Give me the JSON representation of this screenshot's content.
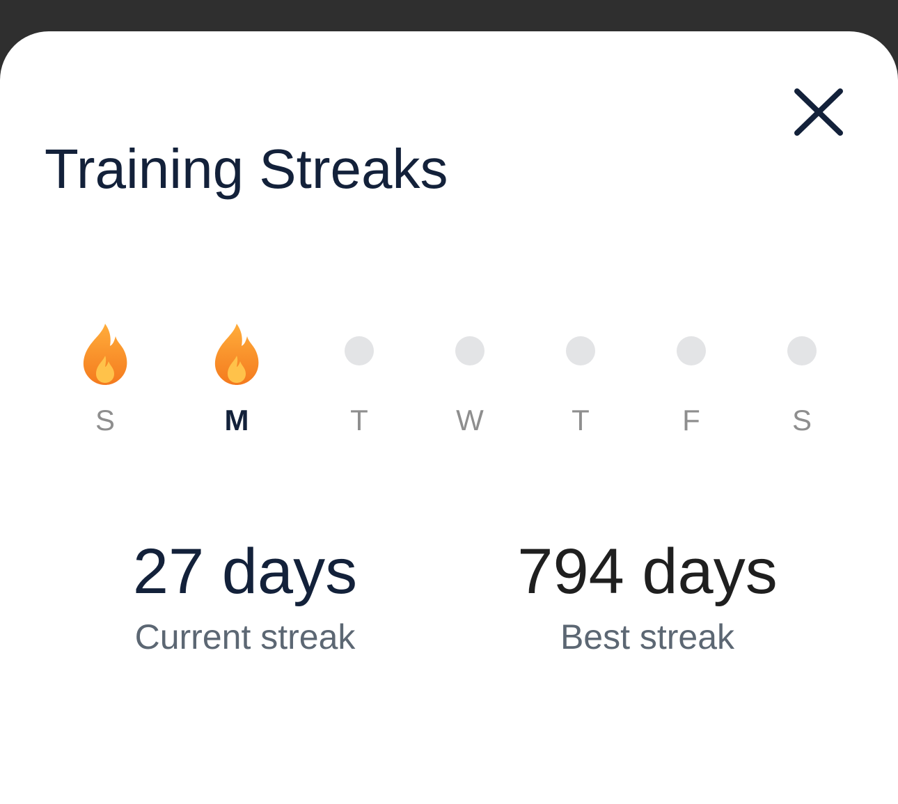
{
  "modal": {
    "title": "Training Streaks",
    "close_icon": "close-icon"
  },
  "week": {
    "days": [
      {
        "letter": "S",
        "state": "completed",
        "icon": "flame-icon"
      },
      {
        "letter": "M",
        "state": "completed",
        "icon": "flame-icon",
        "today": true
      },
      {
        "letter": "T",
        "state": "empty"
      },
      {
        "letter": "W",
        "state": "empty"
      },
      {
        "letter": "T",
        "state": "empty"
      },
      {
        "letter": "F",
        "state": "empty"
      },
      {
        "letter": "S",
        "state": "empty"
      }
    ]
  },
  "stats": {
    "current": {
      "value": "27 days",
      "label": "Current streak"
    },
    "best": {
      "value": "794 days",
      "label": "Best streak"
    }
  },
  "colors": {
    "text_primary": "#13213a",
    "text_secondary": "#5c6773",
    "day_inactive": "#8e8e8e",
    "dot_empty": "#e3e4e6",
    "flame_outer": "#f7931e",
    "flame_inner": "#ffc24a",
    "backdrop": "#2f2f2f"
  }
}
